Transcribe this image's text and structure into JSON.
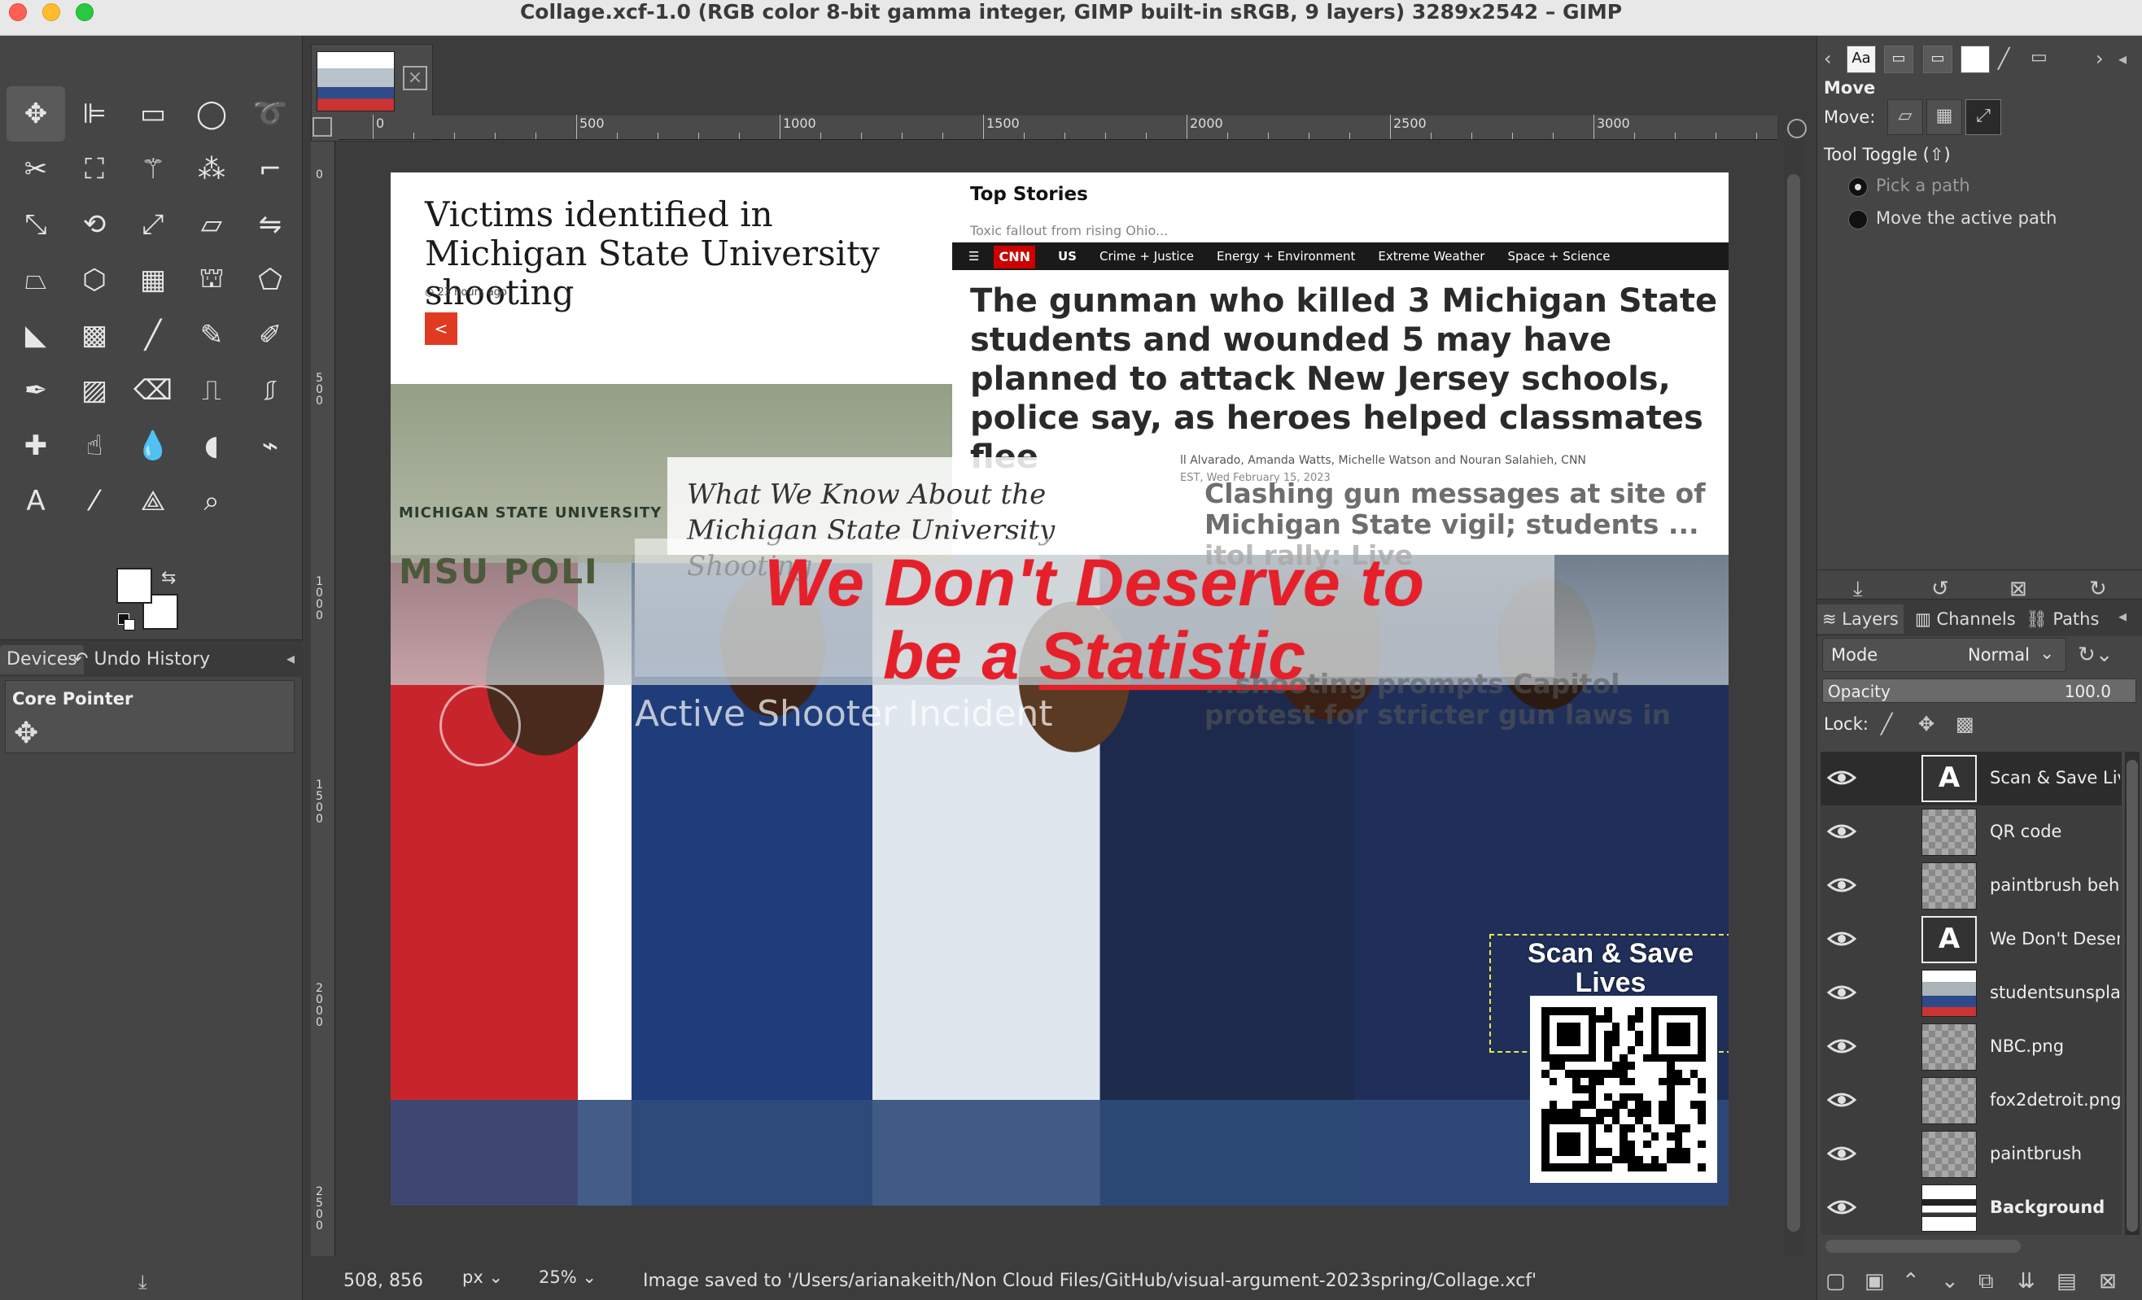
{
  "window": {
    "title": "Collage.xcf-1.0 (RGB color 8-bit gamma integer, GIMP built-in sRGB, 9 layers) 3289x2542 – GIMP"
  },
  "toolbox": {
    "tools": [
      "move-tool-icon",
      "align-tool-icon",
      "rect-select-icon",
      "ellipse-select-icon",
      "free-select-icon",
      "scissors-select-icon",
      "foreground-select-icon",
      "fuzzy-select-icon",
      "select-by-color-icon",
      "crop-icon",
      "unified-transform-icon",
      "rotate-icon",
      "scale-icon",
      "shear-icon",
      "flip-icon",
      "perspective-icon",
      "3d-transform-icon",
      "warp-transform-icon",
      "cage-transform-icon",
      "handle-transform-icon",
      "bucket-fill-icon",
      "gradient-icon",
      "paintbrush-icon",
      "pencil-icon",
      "airbrush-icon",
      "ink-icon",
      "mypaint-brush-icon",
      "eraser-icon",
      "clone-icon",
      "perspective-clone-icon",
      "heal-icon",
      "smudge-icon",
      "blur-icon",
      "dodge-burn-icon",
      "paths-icon",
      "text-icon",
      "color-picker-icon",
      "measure-icon",
      "zoom-icon"
    ]
  },
  "left_dock": {
    "tabs": [
      "Devices",
      "Undo History"
    ],
    "device_title": "Core Pointer"
  },
  "canvas": {
    "headline_left": "Victims identified in Michigan State University shooting",
    "time_ago": "◷ 23 hours ago",
    "top_stories": "Top Stories",
    "teaser": "Toxic fallout from rising Ohio...",
    "cnn_logo": "CNN",
    "cnn_nav": [
      "US",
      "Crime + Justice",
      "Energy + Environment",
      "Extreme Weather",
      "Space + Science"
    ],
    "headline_cnn": "The gunman who killed 3 Michigan State students and wounded 5 may have planned to attack New Jersey schools, police say, as heroes helped classmates flee",
    "byline": "ll Alvarado, Amanda Watts, Michelle Watson and Nouran Salahieh, CNN",
    "byline_date": "EST, Wed February 15, 2023",
    "clashing": "Clashing gun messages at site of Michigan State vigil; students ... itol rally: Live",
    "what_we_know": "What We Know About the Michigan State University Shooting",
    "msu_logo": "MICHIGAN STATE UNIVERSITY",
    "msu_police": "MSU POLI",
    "statement_line1": "We Don't Deserve to",
    "statement_line2a": "be a ",
    "statement_line2b": "Statistic",
    "active_shooter": "Active Shooter Incident",
    "capitol": "...shooting prompts Capitol protest for stricter gun laws in",
    "scan_save": "Scan & Save Lives"
  },
  "rulers": {
    "h_labels": [
      "0",
      "500",
      "1000",
      "1500",
      "2000",
      "2500",
      "3000"
    ],
    "v_labels": [
      "0",
      "500",
      "1000",
      "1500",
      "2000",
      "2500"
    ]
  },
  "status": {
    "coords": "508, 856",
    "unit": "px",
    "zoom": "25%",
    "message": "Image saved to '/Users/arianakeith/Non Cloud Files/GitHub/visual-argument-2023spring/Collage.xcf'"
  },
  "tool_options": {
    "title": "Move",
    "move_label": "Move:",
    "toggle_label": "Tool Toggle  (⇧)",
    "options": [
      {
        "label": "Pick a path",
        "selected": true
      },
      {
        "label": "Move the active path",
        "selected": false
      }
    ]
  },
  "layers_panel": {
    "tabs": [
      "Layers",
      "Channels",
      "Paths"
    ],
    "mode_label": "Mode",
    "mode_value": "Normal",
    "opacity_label": "Opacity",
    "opacity_value": "100.0",
    "opacity": 1.0,
    "lock_label": "Lock:",
    "layers": [
      {
        "name": "Scan & Save Lives",
        "thumb": "text",
        "selected": true
      },
      {
        "name": "QR code",
        "thumb": "transparent"
      },
      {
        "name": "paintbrush behind",
        "thumb": "transparent"
      },
      {
        "name": "We Don't Deserve",
        "thumb": "text"
      },
      {
        "name": "studentsunsplash",
        "thumb": "photo"
      },
      {
        "name": "NBC.png",
        "thumb": "transparent"
      },
      {
        "name": "fox2detroit.png",
        "thumb": "transparent"
      },
      {
        "name": "paintbrush",
        "thumb": "transparent"
      },
      {
        "name": "Background",
        "thumb": "dark",
        "bold": true
      }
    ]
  },
  "colors": {
    "accent_red": "#e5202a",
    "cnn_red": "#cc0000",
    "ui_dark": "#3c3c3c"
  }
}
